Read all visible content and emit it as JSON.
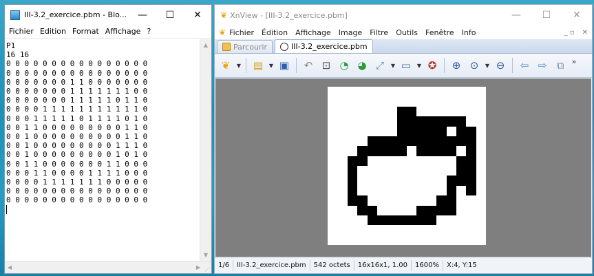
{
  "notepad": {
    "title": "III-3.2_exercice.pbm - Blo...",
    "window_buttons": {
      "minimize": "—",
      "maximize": "☐",
      "close": "✕"
    },
    "menu": [
      "Fichier",
      "Edition",
      "Format",
      "Affichage",
      "?"
    ],
    "lines": [
      "P1",
      "16 16",
      "0 0 0 0 0 0 0 0 0 0 0 0 0 0 0 0",
      "0 0 0 0 0 0 0 0 0 0 0 0 0 0 0 0",
      "0 0 0 0 0 0 0 1 1 0 0 0 0 0 0 0",
      "0 0 0 0 0 0 0 1 1 1 1 1 1 1 0 0",
      "0 0 0 0 0 0 0 1 1 1 1 1 0 1 1 0",
      "0 0 0 0 1 1 1 1 1 1 1 1 1 1 1 0",
      "0 0 0 1 1 1 1 1 0 1 1 1 1 0 1 0",
      "0 0 1 1 0 0 0 0 0 0 0 0 0 1 1 0",
      "0 0 1 0 0 0 0 0 0 0 0 0 0 1 1 0",
      "0 0 1 0 0 0 0 0 0 0 0 0 1 1 1 0",
      "0 0 1 0 0 0 0 0 0 0 0 0 1 0 1 0",
      "0 0 1 1 0 0 0 0 0 0 0 1 1 0 0 0",
      "0 0 0 1 1 0 0 0 0 1 1 1 1 0 0 0",
      "0 0 0 0 1 1 1 1 1 1 1 0 0 0 0 0",
      "0 0 0 0 0 0 0 0 0 0 0 0 0 0 0 0",
      "0 0 0 0 0 0 0 0 0 0 0 0 0 0 0 0"
    ]
  },
  "xnview": {
    "logo": "❦",
    "title": "XnView - [III-3.2_exercice.pbm]",
    "window_buttons": {
      "minimize": "—",
      "maximize": "☐",
      "close": "✕"
    },
    "menu": [
      "Fichier",
      "Édition",
      "Affichage",
      "Image",
      "Filtre",
      "Outils",
      "Fenêtre",
      "Info"
    ],
    "menu_mini": {
      "restore": "_ ▫",
      "close": "✕"
    },
    "tabs": [
      {
        "label": "Parcourir",
        "active": false
      },
      {
        "label": "III-3.2_exercice.pbm",
        "active": true
      }
    ],
    "toolbar_more": "»",
    "image_pixels": [
      "0000000000000000",
      "0000000000000000",
      "0000000110000000",
      "0000000111111100",
      "0000000111110110",
      "0000111111111110",
      "0001111101111010",
      "0011000000000110",
      "0010000000000110",
      "0010000000001110",
      "0010000000001010",
      "0011000000011000",
      "0001100001111000",
      "0000111111100000",
      "0000000000000000",
      "0000000000000000"
    ],
    "status": {
      "index": "1/6",
      "filename": "III-3.2_exercice.pbm",
      "size": "542 octets",
      "dimensions": "16x16x1, 1.00",
      "zoom": "1600%",
      "coords": "X:4, Y:15"
    }
  },
  "colors": {
    "view_background": "#7f7f7f",
    "accent": "#e7a614"
  }
}
